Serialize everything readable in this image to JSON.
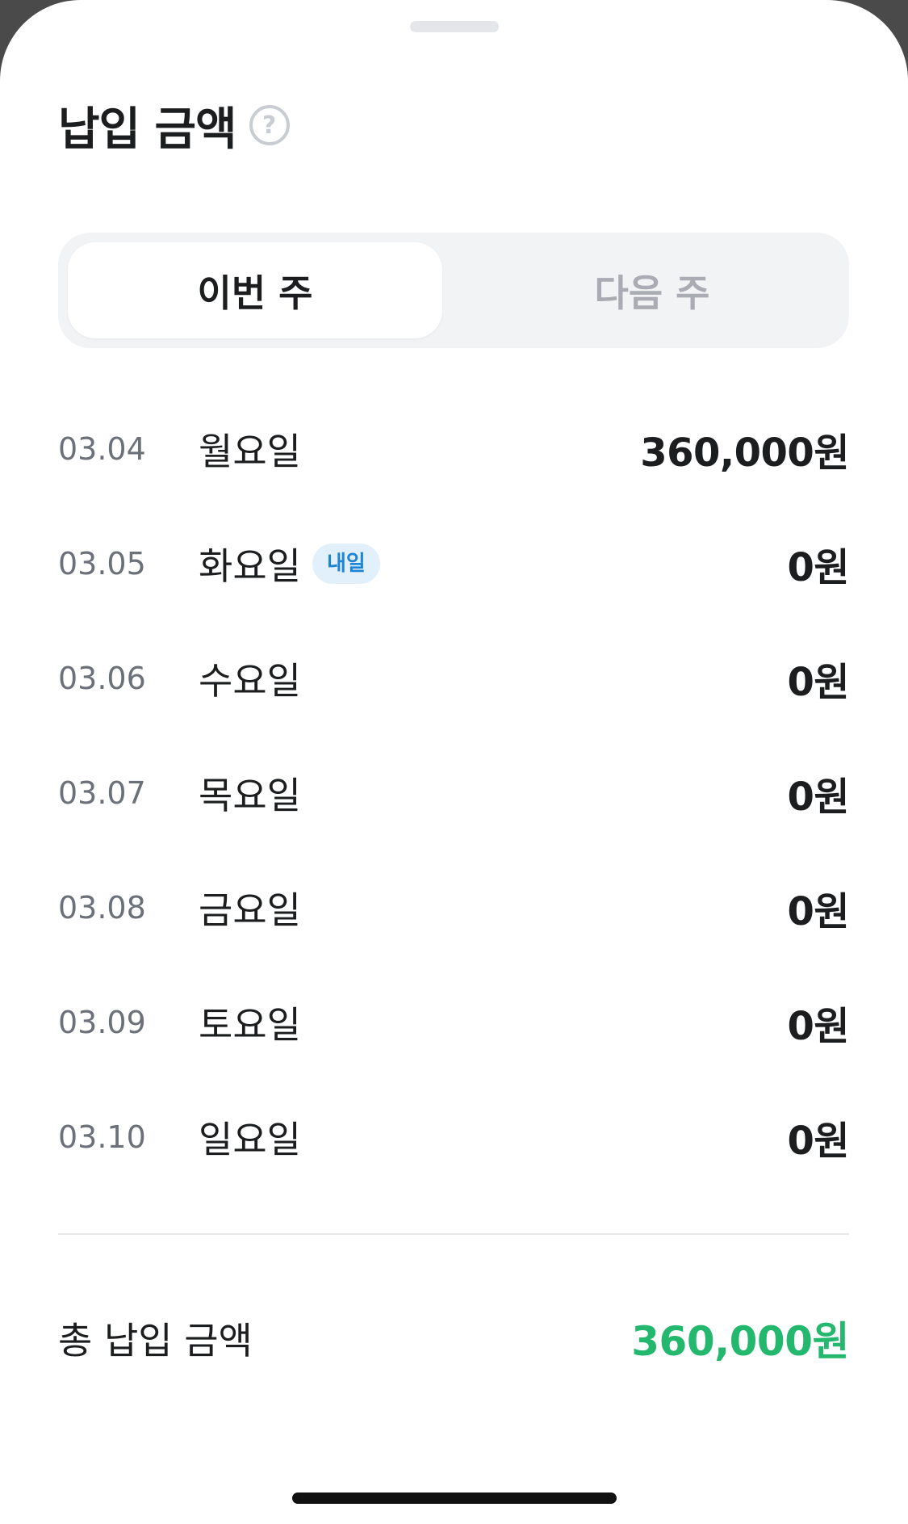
{
  "header": {
    "title": "납입 금액",
    "help_icon": "question-circle-icon",
    "help_glyph": "?"
  },
  "tabs": [
    {
      "label": "이번 주",
      "active": true
    },
    {
      "label": "다음 주",
      "active": false
    }
  ],
  "days": [
    {
      "date": "03.04",
      "weekday": "월요일",
      "badge": "",
      "amount": "360,000원"
    },
    {
      "date": "03.05",
      "weekday": "화요일",
      "badge": "내일",
      "amount": "0원"
    },
    {
      "date": "03.06",
      "weekday": "수요일",
      "badge": "",
      "amount": "0원"
    },
    {
      "date": "03.07",
      "weekday": "목요일",
      "badge": "",
      "amount": "0원"
    },
    {
      "date": "03.08",
      "weekday": "금요일",
      "badge": "",
      "amount": "0원"
    },
    {
      "date": "03.09",
      "weekday": "토요일",
      "badge": "",
      "amount": "0원"
    },
    {
      "date": "03.10",
      "weekday": "일요일",
      "badge": "",
      "amount": "0원"
    }
  ],
  "total": {
    "label": "총 납입 금액",
    "amount": "360,000원"
  },
  "colors": {
    "accent_green": "#23b86e",
    "badge_blue": "#1d84d6",
    "badge_bg": "#e1f0fb"
  }
}
